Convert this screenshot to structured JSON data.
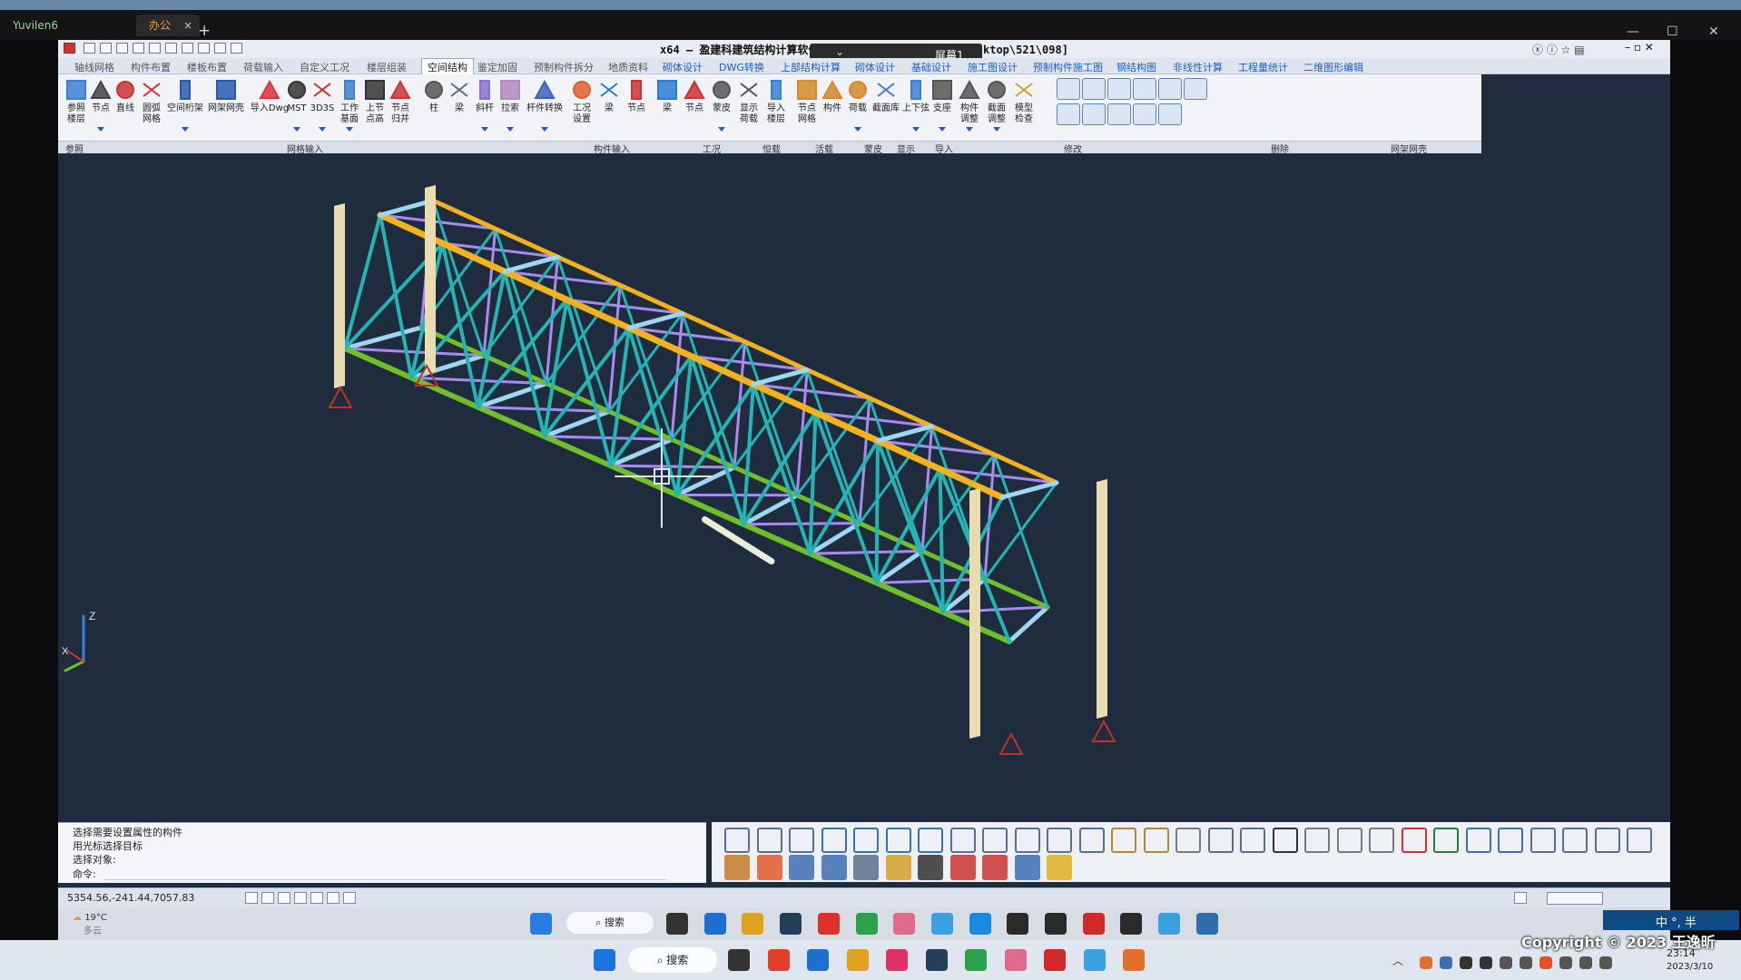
{
  "outer": {
    "tab1": "Yuvilen6",
    "tab2": "办公",
    "tab_close": "×",
    "new_tab": "+"
  },
  "app": {
    "title": "x64 – 盈建科建筑结构计算软件 ... [C:\\Users\\Lenovo\\Desktop\\521\\098]",
    "screen_badge": "屏幕1",
    "menus": [
      {
        "label": "轴线网格",
        "colored": false
      },
      {
        "label": "构件布置",
        "colored": false
      },
      {
        "label": "楼板布置",
        "colored": false
      },
      {
        "label": "荷载输入",
        "colored": false
      },
      {
        "label": "自定义工况",
        "colored": false
      },
      {
        "label": "楼层组装",
        "colored": false
      },
      {
        "label": "空间结构",
        "colored": false,
        "active": true
      },
      {
        "label": "鉴定加固",
        "colored": false
      },
      {
        "label": "预制构件拆分",
        "colored": false
      },
      {
        "label": "地质资料",
        "colored": false
      },
      {
        "label": "砌体设计",
        "colored": true
      },
      {
        "label": "DWG转换",
        "colored": true
      },
      {
        "label": "上部结构计算",
        "colored": true
      },
      {
        "label": "砌体设计",
        "colored": true
      },
      {
        "label": "基础设计",
        "colored": true
      },
      {
        "label": "施工图设计",
        "colored": true
      },
      {
        "label": "预制构件施工图",
        "colored": true
      },
      {
        "label": "钢结构图",
        "colored": true
      },
      {
        "label": "非线性计算",
        "colored": true
      },
      {
        "label": "工程量统计",
        "colored": true
      },
      {
        "label": "二维图形编辑",
        "colored": true
      }
    ],
    "tools": [
      {
        "l1": "参照",
        "l2": "楼层",
        "icon": "layers-icon",
        "color": "#3d7fd4"
      },
      {
        "l1": "节点",
        "l2": "",
        "icon": "node-icon",
        "color": "#444"
      },
      {
        "l1": "直线",
        "l2": "",
        "icon": "line-icon",
        "color": "#c33"
      },
      {
        "l1": "圆弧",
        "l2": "网格",
        "icon": "arc-grid-icon",
        "color": "#c33"
      },
      {
        "l1": "空间桁架",
        "l2": "",
        "icon": "truss-icon",
        "color": "#2a5ab0"
      },
      {
        "l1": "网架网壳",
        "l2": "",
        "icon": "space-frame-icon",
        "color": "#2a5ab0"
      },
      {
        "l1": "导入Dwg",
        "l2": "",
        "icon": "import-dwg-icon",
        "color": "#d33"
      },
      {
        "l1": "MST",
        "l2": "",
        "icon": "mst-icon",
        "color": "#333"
      },
      {
        "l1": "3D3S",
        "l2": "",
        "icon": "3d3s-icon",
        "color": "#c3322b"
      },
      {
        "l1": "工作",
        "l2": "基面",
        "icon": "workplane-icon",
        "color": "#3d7fd4"
      },
      {
        "l1": "上节",
        "l2": "点高",
        "icon": "node-height-icon",
        "color": "#333"
      },
      {
        "l1": "节点",
        "l2": "归并",
        "icon": "node-merge-icon",
        "color": "#c33"
      },
      {
        "l1": "柱",
        "l2": "",
        "icon": "column-icon",
        "color": "#555"
      },
      {
        "l1": "梁",
        "l2": "",
        "icon": "beam-icon",
        "color": "#5c6f86"
      },
      {
        "l1": "斜杆",
        "l2": "",
        "icon": "brace-icon",
        "color": "#8a6fd0"
      },
      {
        "l1": "拉索",
        "l2": "",
        "icon": "cable-icon",
        "color": "#b08ac0"
      },
      {
        "l1": "杆件转换",
        "l2": "",
        "icon": "member-convert-icon",
        "color": "#3d5fc0"
      },
      {
        "l1": "工况",
        "l2": "设置",
        "icon": "load-case-icon",
        "color": "#e0602a"
      },
      {
        "l1": "梁",
        "l2": "",
        "icon": "beam-load-icon",
        "color": "#2a7bd4"
      },
      {
        "l1": "节点",
        "l2": "",
        "icon": "node-load-icon",
        "color": "#c33"
      },
      {
        "l1": "梁",
        "l2": "",
        "icon": "live-beam-icon",
        "color": "#2a7bd4"
      },
      {
        "l1": "节点",
        "l2": "",
        "icon": "live-node-icon",
        "color": "#c33"
      },
      {
        "l1": "蒙皮",
        "l2": "",
        "icon": "skin-icon",
        "color": "#555"
      },
      {
        "l1": "显示",
        "l2": "荷载",
        "icon": "show-load-icon",
        "color": "#555"
      },
      {
        "l1": "导入",
        "l2": "楼层",
        "icon": "import-floor-icon",
        "color": "#3d7fd4"
      },
      {
        "l1": "节点",
        "l2": "网格",
        "icon": "delete-node-icon",
        "color": "#d48a2a"
      },
      {
        "l1": "构件",
        "l2": "",
        "icon": "delete-member-icon",
        "color": "#d48a2a"
      },
      {
        "l1": "荷载",
        "l2": "",
        "icon": "delete-load-icon",
        "color": "#d48a2a"
      },
      {
        "l1": "截面库",
        "l2": "",
        "icon": "section-lib-icon",
        "color": "#3d7fd4"
      },
      {
        "l1": "上下弦",
        "l2": "",
        "icon": "chord-icon",
        "color": "#3d7fd4"
      },
      {
        "l1": "支座",
        "l2": "",
        "icon": "support-icon",
        "color": "#555"
      },
      {
        "l1": "构件",
        "l2": "调整",
        "icon": "member-adjust-icon",
        "color": "#555"
      },
      {
        "l1": "截面",
        "l2": "调整",
        "icon": "section-adjust-icon",
        "color": "#555"
      },
      {
        "l1": "模型",
        "l2": "检查",
        "icon": "model-check-icon",
        "color": "#d4a02a"
      }
    ],
    "groups": [
      "参照",
      "网格输入",
      "构件输入",
      "工况",
      "恒载",
      "活载",
      "蒙皮",
      "显示",
      "导入",
      "修改",
      "删除",
      "网架网壳"
    ],
    "command_lines": [
      "选择需要设置属性的构件",
      "用光标选择目标",
      "选择对象:",
      "命令:"
    ],
    "coords": "5354.56,-241.44,7057.83",
    "axis_z": "Z",
    "axis_x": "X"
  },
  "inner_taskbar": {
    "temp": "19°C",
    "weather_text": "多云",
    "search": "搜索"
  },
  "taskbar": {
    "search": "搜索",
    "time": "23:14",
    "date": "2023/3/10",
    "ime": "中 °, 半"
  },
  "copyright": "Copyright © 2023 王逸昕",
  "colors": {
    "viewport_bg": "#1e2c3e",
    "top_chord": "#f2b21d",
    "bottom_chord": "#6fbf2a",
    "web_member": "#25b3b3",
    "purple_brace": "#a78bf0",
    "light_beam": "#9fd6f2",
    "column": "#e9dcb1",
    "support": "#c0302a"
  }
}
